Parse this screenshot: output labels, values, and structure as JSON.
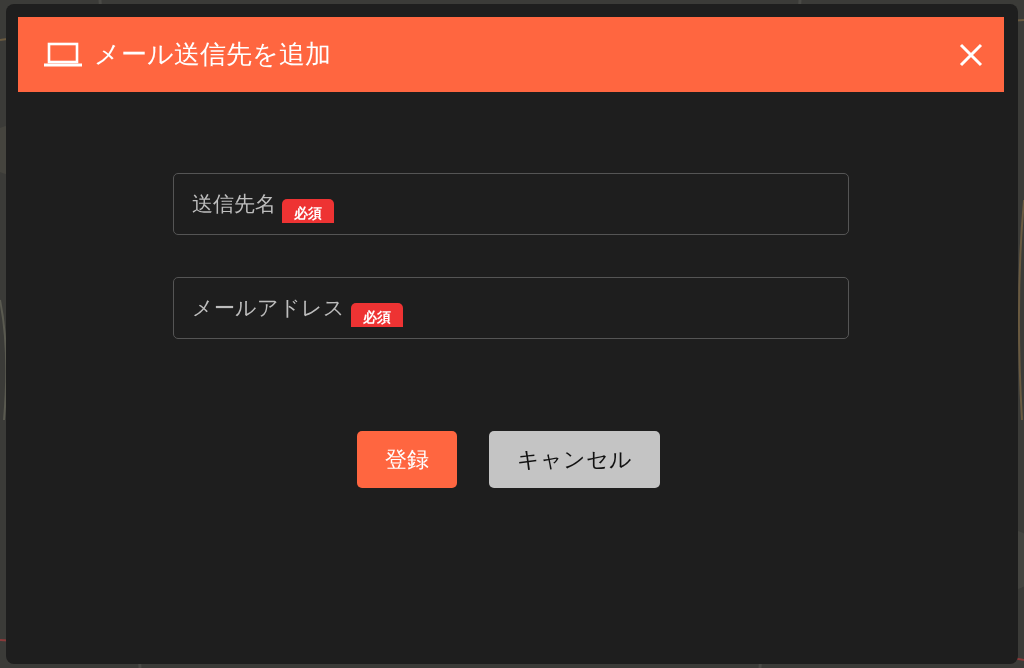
{
  "dialog": {
    "title": "メール送信先を追加"
  },
  "fields": [
    {
      "label": "送信先名",
      "badge": "必須"
    },
    {
      "label": "メールアドレス",
      "badge": "必須"
    }
  ],
  "buttons": [
    {
      "label": "登録",
      "kind": "primary"
    },
    {
      "label": "キャンセル",
      "kind": "secondary"
    }
  ]
}
